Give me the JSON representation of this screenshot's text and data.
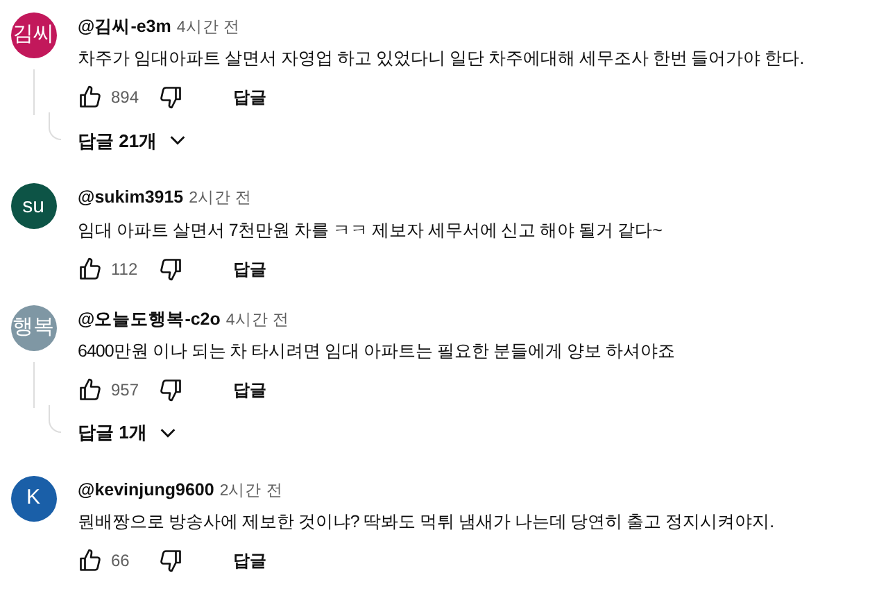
{
  "comments": [
    {
      "avatar": "김씨",
      "color": "#c2185b",
      "handle": "@김씨-e3m",
      "time": "4시간 전",
      "text": "차주가 임대아파트 살면서 자영업 하고 있었다니 일단 차주에대해 세무조사 한번 들어가야 한다.",
      "likes": "894",
      "reply": "답글",
      "replies": "답글 21개"
    },
    {
      "avatar": "su",
      "color": "#0d5446",
      "handle": "@sukim3915",
      "time": "2시간 전",
      "text": "임대 아파트 살면서 7천만원 차를 ㅋㅋ  제보자 세무서에 신고 해야 될거 같다~",
      "likes": "112",
      "reply": "답글"
    },
    {
      "avatar": "행복",
      "color": "#7f97a4",
      "handle": "@오늘도행복-c2o",
      "time": "4시간 전",
      "text": "6400만원 이나 되는 차 타시려면 임대 아파트는 필요한 분들에게 양보 하셔야죠",
      "likes": "957",
      "reply": "답글",
      "replies": "답글 1개"
    },
    {
      "avatar": "K",
      "color": "#1a5fa8",
      "handle": "@kevinjung9600",
      "time": "2시간 전",
      "text": "뭔배짱으로 방송사에 제보한 것이냐? 딱봐도 먹튀 냄새가 나는데 당연히 출고 정지시켜야지.",
      "likes": "66",
      "reply": "답글"
    }
  ]
}
